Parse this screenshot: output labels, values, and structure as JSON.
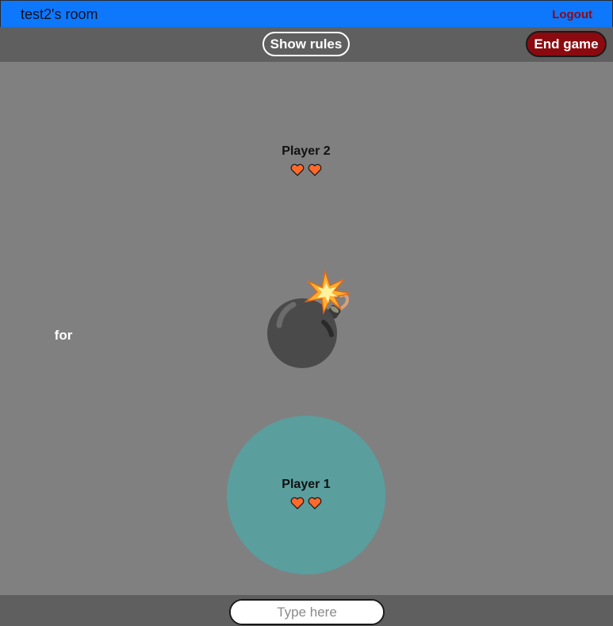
{
  "header": {
    "room_title": "test2's room",
    "logout_label": "Logout"
  },
  "toolbar": {
    "rules_label": "Show rules",
    "end_game_label": "End game"
  },
  "game": {
    "bomb_word": "for",
    "players": [
      {
        "name": "Player 2",
        "lives": 2,
        "active": false
      },
      {
        "name": "Player 1",
        "lives": 2,
        "active": true
      }
    ]
  },
  "footer": {
    "input_placeholder": "Type here",
    "input_value": ""
  },
  "colors": {
    "header_bg": "#0d78fc",
    "toolbar_bg": "#5f5f5f",
    "game_bg": "#808080",
    "active_player": "#5a9e9e",
    "end_game_bg": "#8b0a0f",
    "logout_text": "#8b0a1a",
    "heart": "#ff6a2b"
  },
  "icons": {
    "heart": "heart-icon",
    "bomb": "bomb-icon"
  }
}
